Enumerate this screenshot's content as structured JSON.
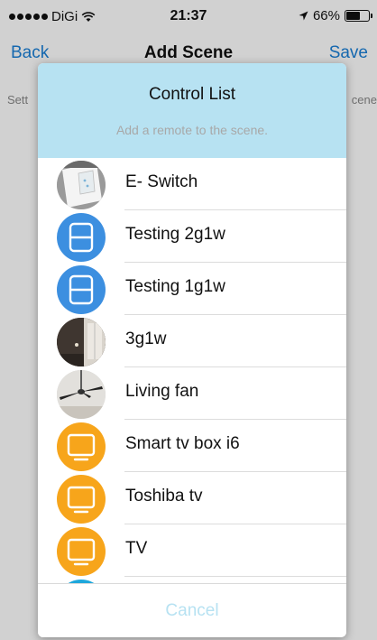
{
  "status_bar": {
    "carrier": "DiGi",
    "time": "21:37",
    "battery_text": "66%",
    "battery_level": 0.66
  },
  "nav": {
    "back_label": "Back",
    "title": "Add Scene",
    "save_label": "Save",
    "background_text_left": "Sett",
    "background_text_right": "cene"
  },
  "modal": {
    "title": "Control List",
    "subtitle": "Add a remote to the scene.",
    "cancel_label": "Cancel",
    "items": [
      {
        "label": "E- Switch",
        "icon": "switch-photo-icon"
      },
      {
        "label": "Testing 2g1w",
        "icon": "switch-panel-icon"
      },
      {
        "label": "Testing 1g1w",
        "icon": "switch-panel-icon"
      },
      {
        "label": "3g1w",
        "icon": "room-photo-icon"
      },
      {
        "label": "Living fan",
        "icon": "fan-photo-icon"
      },
      {
        "label": "Smart tv box i6",
        "icon": "tv-icon"
      },
      {
        "label": "Toshiba tv",
        "icon": "tv-icon"
      },
      {
        "label": "TV",
        "icon": "tv-icon"
      }
    ]
  },
  "colors": {
    "accent_blue": "#1a7fd6",
    "header_bg": "#b7e2f2",
    "panel_blue": "#3c8fe0",
    "tv_orange": "#f7a51b"
  }
}
